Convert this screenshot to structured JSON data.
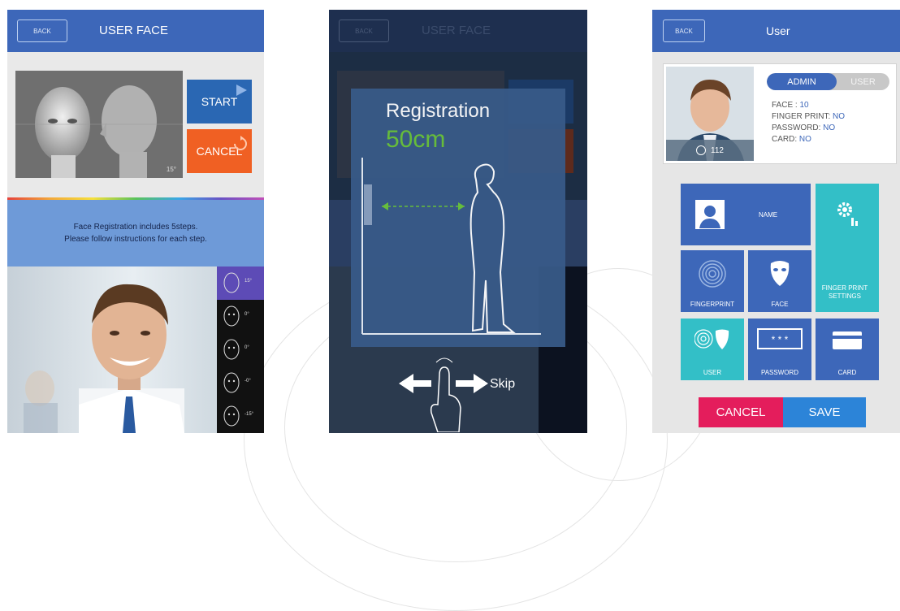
{
  "screen1": {
    "back_label": "BACK",
    "title": "USER FACE",
    "start_label": "START",
    "cancel_label": "CANCEL",
    "angle_label": "15°",
    "instruction_line1": "Face Registration includes 5steps.",
    "instruction_line2": "Please follow instructions for each step.",
    "steps": [
      "15°",
      "0°",
      "0°",
      "-0°",
      "-15°"
    ]
  },
  "screen2": {
    "back_label": "BACK",
    "title": "USER FACE",
    "registration_label": "Registration",
    "distance_label": "50cm",
    "skip_label": "Skip"
  },
  "screen3": {
    "back_label": "BACK",
    "title": "User",
    "admin_label": "ADMIN",
    "user_label": "USER",
    "user_id": "112",
    "face_key": "FACE : ",
    "face_val": "10",
    "fp_key": "FINGER PRINT: ",
    "fp_val": "NO",
    "pw_key": "PASSWORD: ",
    "pw_val": "NO",
    "card_key": "CARD: ",
    "card_val": "NO",
    "tiles": {
      "name": "NAME",
      "fp_settings": "FINGER PRINT SETTINGS",
      "fingerprint": "FINGERPRINT",
      "face": "FACE",
      "user": "USER",
      "password": "PASSWORD",
      "card": "CARD"
    },
    "cancel_label": "CANCEL",
    "save_label": "SAVE"
  },
  "colors": {
    "header_blue": "#3d67b9",
    "start_blue": "#2a67b3",
    "cancel_orange": "#f06023",
    "teal": "#33bfc7",
    "cancel_pink": "#e41d5c",
    "save_blue": "#2c84d8",
    "accent_green": "#6ac43b"
  }
}
